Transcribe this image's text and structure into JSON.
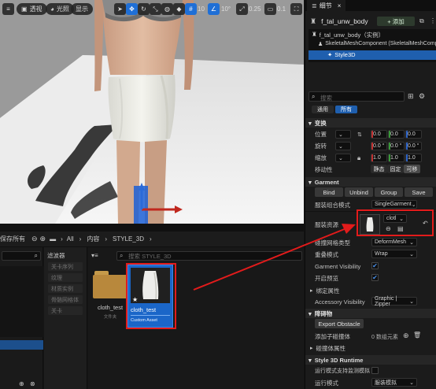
{
  "viewport": {
    "btn_perspective": "透视",
    "btn_lit": "光照",
    "btn_show": "显示",
    "grid_snap_value": "10",
    "rot_snap_value": "10°",
    "scale_snap_value": "0.25",
    "camera_speed_value": "0.1"
  },
  "content_browser": {
    "save_all": "保存所有",
    "path": [
      "All",
      "内容",
      "STYLE_3D"
    ],
    "filter_title": "滤波器",
    "filter_items": [
      "关卡序列",
      "纹理",
      "材质实例",
      "骨骼网格体",
      "关卡"
    ],
    "search_placeholder": "搜索 STYLE_3D",
    "assets": [
      {
        "name": "cloth_test",
        "type": "文件夹"
      },
      {
        "name": "cloth_test",
        "type": "Custom Asset",
        "star": "★"
      }
    ]
  },
  "details": {
    "tab_title": "细节",
    "object_name": "f_tal_unw_body",
    "add_button": "+ 添加",
    "tree": [
      "f_tal_unw_body（实例）",
      "SkeletalMeshComponent (SkeletalMeshComponent)",
      "Style3D"
    ],
    "search_placeholder": "搜索",
    "tabs": [
      "通用",
      "所有"
    ],
    "transform": {
      "section": "变换",
      "location_label": "位置",
      "location": [
        "0.0",
        "0.0",
        "0.0"
      ],
      "rotation_label": "旋转",
      "rotation": [
        "0.0 °",
        "0.0 °",
        "0.0 °"
      ],
      "scale_label": "缩放",
      "scale": [
        "1.0",
        "1.0",
        "1.0"
      ],
      "mobility_label": "移动性",
      "mobility_options": [
        "静态",
        "固定",
        "可移"
      ]
    },
    "garment": {
      "section": "Garment",
      "buttons": [
        "Bind",
        "Unbind",
        "Group",
        "Save"
      ],
      "mode_label": "服装组合模式",
      "mode_value": "SingleGarment",
      "asset_label": "服装资源",
      "asset_value": "clotl",
      "mesh_type_label": "碰撞网格类型",
      "mesh_type_value": "DeformMesh",
      "overlap_label": "重叠模式",
      "overlap_value": "Wrap",
      "visibility_label": "Garment Visibility",
      "visibility_checked": "✔",
      "preview_label": "开启预览",
      "preview_checked": "✔"
    },
    "binding_section": "绑定属性",
    "accessory_label": "Accessory Visibility",
    "accessory_value": "Graphic | Zipper",
    "obstacle": {
      "section": "障碍物",
      "button": "Export Obstacle",
      "add_label": "添加子碰撞体",
      "add_value": "0 数组元素",
      "collision_section": "碰撞体属性"
    },
    "runtime": {
      "section": "Style 3D Runtime",
      "row1_label": "运行模式支持监测模拟",
      "row2_label": "运行模式",
      "row2_value": "服装模拟"
    }
  }
}
